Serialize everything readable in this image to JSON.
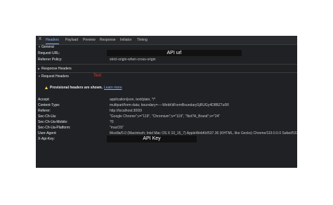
{
  "tabs": {
    "close": "X",
    "items": [
      "Headers",
      "Payload",
      "Preview",
      "Response",
      "Initiator",
      "Timing"
    ]
  },
  "general": {
    "title": "General",
    "request_url_label": "Request URL:",
    "request_url_redacted": "API url",
    "referrer_policy_label": "Referrer Policy:",
    "referrer_policy_value": "strict-origin-when-cross-origin"
  },
  "response_headers": {
    "title": "Response Headers"
  },
  "request_headers": {
    "title": "Request Headers",
    "annotation": "Text"
  },
  "warning": {
    "text": "Provisional headers are shown.",
    "link": "Learn more"
  },
  "headers": [
    {
      "k": "Accept:",
      "v": "application/json, text/plain, */*"
    },
    {
      "k": "Content-Type:",
      "v": "multipart/form-data; boundary=----WebKitFormBoundarySjRUGy4D8BZ7u0R"
    },
    {
      "k": "Referer:",
      "v": "http://localhost:3000/"
    },
    {
      "k": "Sec-Ch-Ua:",
      "v": "\"Google Chrome\";v=\"119\", \"Chromium\";v=\"119\", \"Not?A_Brand\";v=\"24\""
    },
    {
      "k": "Sec-Ch-Ua-Mobile:",
      "v": "?0"
    },
    {
      "k": "Sec-Ch-Ua-Platform:",
      "v": "\"macOS\""
    },
    {
      "k": "User-Agent:",
      "v": "Mozilla/5.0 (Macintosh; Intel Mac OS X 10_15_7) AppleWebKit/537.36 (KHTML, like Gecko) Chrome/119.0.0.0 Safari/537.36"
    },
    {
      "k": "X-Api-Key:",
      "v": ""
    }
  ],
  "api_key_redacted": "API Key",
  "colors": {
    "panel_bg": "#202124",
    "tab_active": "#8ab4f8",
    "warning_icon": "#fdd663",
    "annotation": "#ff2d2d"
  }
}
